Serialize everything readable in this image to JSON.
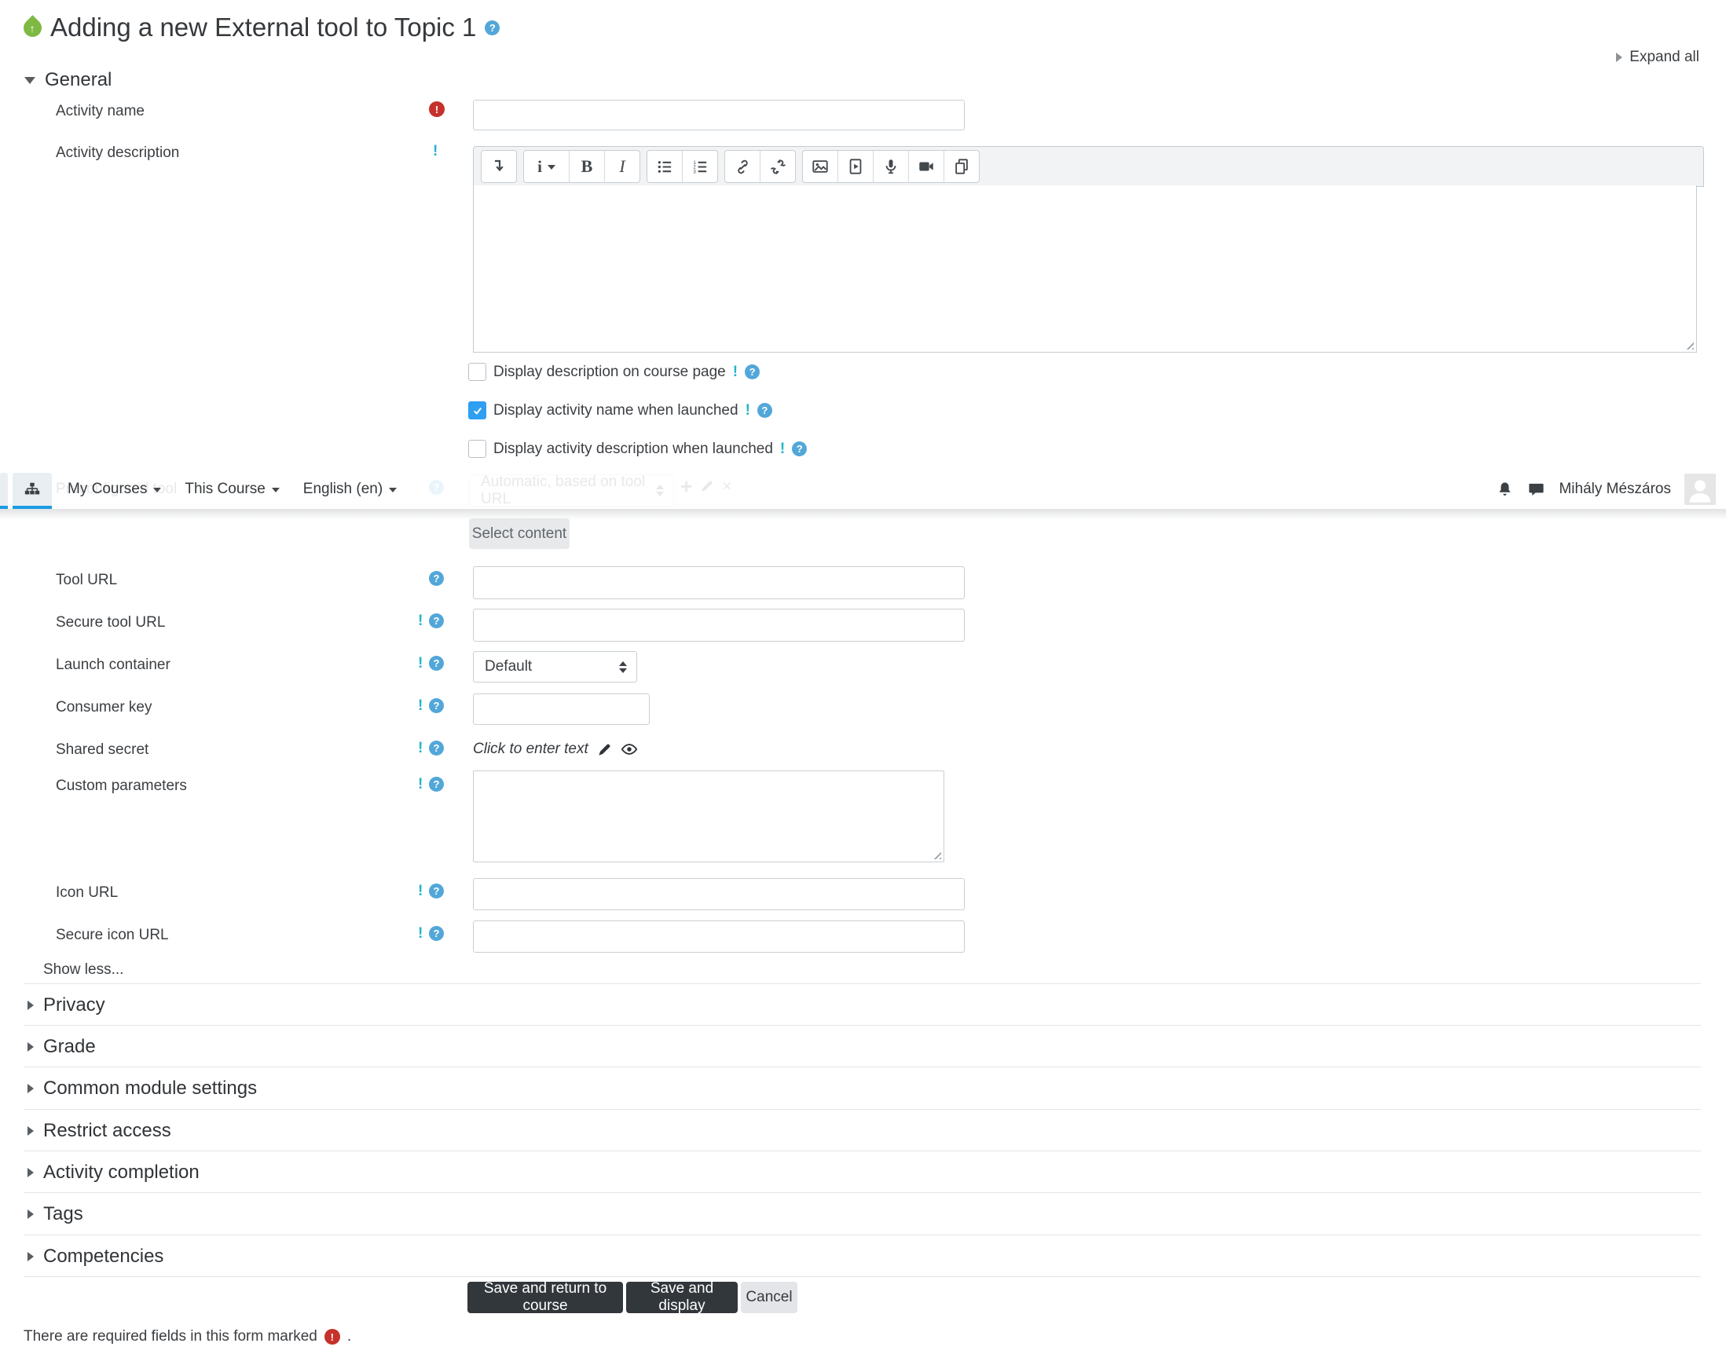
{
  "header": {
    "title": "Adding a new External tool to Topic 1",
    "help_glyph": "?",
    "expand_all": "Expand all"
  },
  "navbar": {
    "menus": [
      "My Courses",
      "This Course",
      "English (en)"
    ],
    "user_name": "Mihály Mészáros"
  },
  "general": {
    "label": "General",
    "activity_name_label": "Activity name",
    "activity_description_label": "Activity description",
    "checkboxes": [
      {
        "label": "Display description on course page",
        "checked": false
      },
      {
        "label": "Display activity name when launched",
        "checked": true
      },
      {
        "label": "Display activity description when launched",
        "checked": false
      }
    ],
    "preconfigured_tool_label": "Preconfigured tool",
    "preconfigured_tool_value": "Automatic, based on tool URL",
    "preconfigured_add_glyph": "+",
    "preconfigured_delete_glyph": "×",
    "select_content": "Select content",
    "tool_url_label": "Tool URL",
    "secure_tool_url_label": "Secure tool URL",
    "launch_container_label": "Launch container",
    "launch_container_value": "Default",
    "consumer_key_label": "Consumer key",
    "shared_secret_label": "Shared secret",
    "shared_secret_placeholder": "Click to enter text",
    "custom_parameters_label": "Custom parameters",
    "icon_url_label": "Icon URL",
    "secure_icon_url_label": "Secure icon URL",
    "show_less": "Show less...",
    "required_glyph": "!",
    "advanced_glyph": "!"
  },
  "editor": {
    "styles_glyph": "i",
    "bold_glyph": "B",
    "italic_glyph": "I"
  },
  "sections": [
    "Privacy",
    "Grade",
    "Common module settings",
    "Restrict access",
    "Activity completion",
    "Tags",
    "Competencies"
  ],
  "actions": {
    "save_return": "Save and return to course",
    "save_display": "Save and display",
    "cancel": "Cancel"
  },
  "footer": {
    "required_note": "There are required fields in this form marked",
    "period": "."
  }
}
